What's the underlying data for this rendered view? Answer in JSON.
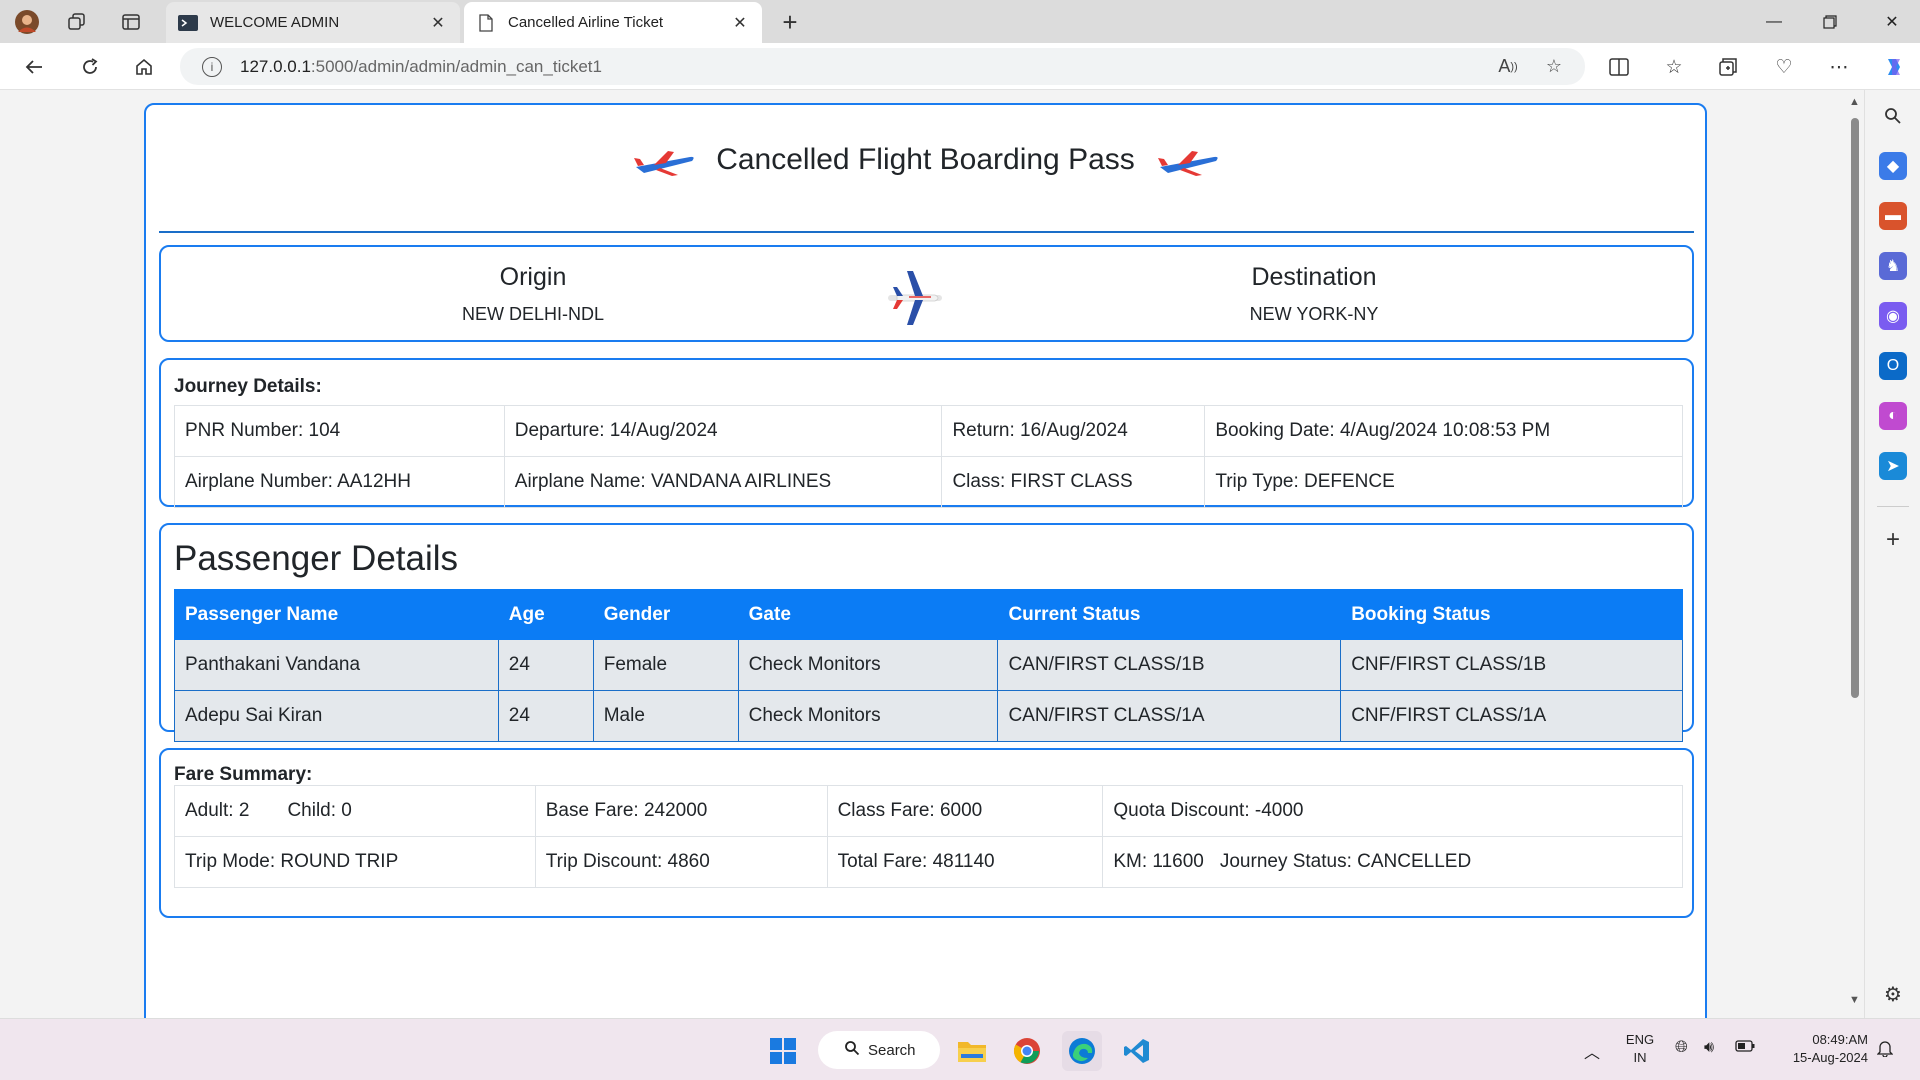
{
  "browser": {
    "tabs": [
      {
        "title": "WELCOME ADMIN",
        "active": false
      },
      {
        "title": "Cancelled Airline Ticket",
        "active": true
      }
    ],
    "url_host": "127.0.0.1",
    "url_path": ":5000/admin/admin/admin_can_ticket1"
  },
  "page": {
    "title": "Cancelled Flight Boarding Pass",
    "origin": {
      "label": "Origin",
      "value": "NEW DELHI-NDL"
    },
    "destination": {
      "label": "Destination",
      "value": "NEW YORK-NY"
    },
    "journey": {
      "heading": "Journey Details:",
      "pnr": "PNR Number: 104",
      "departure": "Departure: 14/Aug/2024",
      "return": "Return: 16/Aug/2024",
      "booking_date": "Booking Date: 4/Aug/2024 10:08:53 PM",
      "airplane_number": "Airplane Number: AA12HH",
      "airplane_name": "Airplane Name: VANDANA AIRLINES",
      "class": "Class: FIRST CLASS",
      "trip_type": "Trip Type: DEFENCE"
    },
    "passengers": {
      "heading": "Passenger Details",
      "columns": [
        "Passenger Name",
        "Age",
        "Gender",
        "Gate",
        "Current Status",
        "Booking Status"
      ],
      "rows": [
        [
          "Panthakani Vandana",
          "24",
          "Female",
          "Check Monitors",
          "CAN/FIRST CLASS/1B",
          "CNF/FIRST CLASS/1B"
        ],
        [
          "Adepu Sai Kiran",
          "24",
          "Male",
          "Check Monitors",
          "CAN/FIRST CLASS/1A",
          "CNF/FIRST CLASS/1A"
        ]
      ]
    },
    "fare": {
      "heading": "Fare Summary:",
      "adult": "Adult: 2",
      "child": "Child: 0",
      "base_fare": "Base Fare: 242000",
      "class_fare": "Class Fare: 6000",
      "quota_discount": "Quota Discount: -4000",
      "trip_mode": "Trip Mode: ROUND TRIP",
      "trip_discount": "Trip Discount: 4860",
      "total_fare": "Total Fare: 481140",
      "km": "KM: 11600",
      "journey_status": "Journey Status: CANCELLED"
    }
  },
  "taskbar": {
    "search_label": "Search",
    "lang_line1": "ENG",
    "lang_line2": "IN",
    "time": "08:49:AM",
    "date": "15-Aug-2024"
  },
  "colors": {
    "accent": "#1a7cf0",
    "table_header": "#0b7cf5"
  }
}
